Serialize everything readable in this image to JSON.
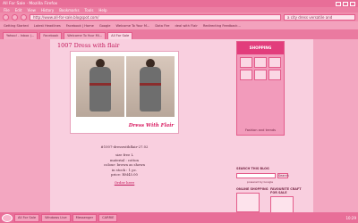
{
  "browser": {
    "title": "All For Sale · Mozilla Firefox",
    "menu": [
      "File",
      "Edit",
      "View",
      "History",
      "Bookmarks",
      "Tools",
      "Help"
    ],
    "url": "http://www.all-for-sale.blogspot.com/",
    "search_value": "a city dress versatile and",
    "bookmarks": [
      "Getting Started",
      "Latest Headlines",
      "Facebook | Home",
      "Google",
      "Welcome To Your M...",
      "Dota Fire",
      "deal with Flair",
      "Redirecting Feedback..."
    ],
    "tabs": [
      "Yahoo! - Inbox (... ",
      "Facebook",
      "Welcome To Your Mi...",
      "All For Sale"
    ]
  },
  "post": {
    "title": "1007 Dress with flair",
    "logo_text": "Dress With Flair",
    "details": [
      "#1007-dresswithflair-27.02",
      "size free L",
      "material : cotton",
      "colour: brown as shown",
      "in stock : 1 pc.",
      "price:  RM45.00"
    ],
    "order_label": "Order here"
  },
  "sidebar": {
    "ad_head": "SHOPPING",
    "ad_foot": "Fashion and trends",
    "search_title": "Search This Blog",
    "search_button": "Search",
    "powered_by": "powered by Google",
    "online_shopping": "Online Shopping",
    "favourite": "Favourite Craft For Sale"
  },
  "taskbar": {
    "items": [
      "All For Sale",
      "Windows Live",
      "Messenger",
      "CARRIE"
    ],
    "clock": "10:29"
  }
}
